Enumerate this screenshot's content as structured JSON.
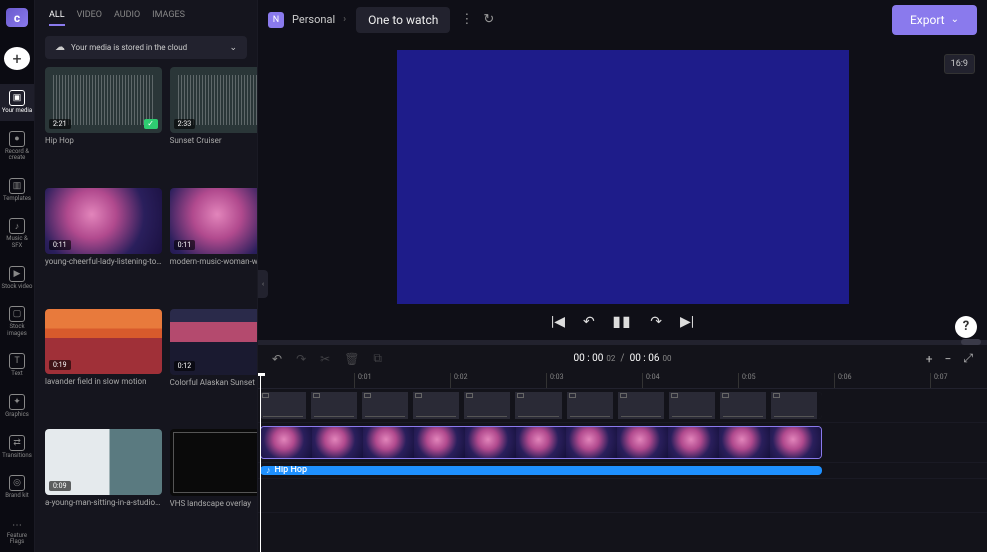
{
  "rail": {
    "items": [
      {
        "label": "Your media"
      },
      {
        "label": "Record & create"
      },
      {
        "label": "Templates"
      },
      {
        "label": "Music & SFX"
      },
      {
        "label": "Stock video"
      },
      {
        "label": "Stock images"
      },
      {
        "label": "Text"
      },
      {
        "label": "Graphics"
      },
      {
        "label": "Transitions"
      },
      {
        "label": "Brand kit"
      }
    ],
    "flags_label": "Feature Flags"
  },
  "tabs": {
    "all": "ALL",
    "video": "VIDEO",
    "audio": "AUDIO",
    "images": "IMAGES"
  },
  "cloud_bar": "Your media is stored in the cloud",
  "media": [
    {
      "dur": "2:21",
      "name": "Hip Hop",
      "check": true,
      "style": "audio"
    },
    {
      "dur": "2:33",
      "name": "Sunset Cruiser",
      "check": false,
      "style": "audio"
    },
    {
      "dur": "0:11",
      "name": "young-cheerful-lady-listening-to…",
      "check": false,
      "style": "woman"
    },
    {
      "dur": "0:11",
      "name": "modern-music-woman-wearing-…",
      "check": true,
      "style": "woman"
    },
    {
      "dur": "0:19",
      "name": "lavander field in slow motion",
      "check": false,
      "style": "lavender"
    },
    {
      "dur": "0:12",
      "name": "Colorful Alaskan Sunset",
      "check": false,
      "style": "alaska"
    },
    {
      "dur": "0:09",
      "name": "a-young-man-sitting-in-a-studio…",
      "check": false,
      "style": "man"
    },
    {
      "dur": "",
      "name": "VHS landscape overlay",
      "check": true,
      "style": "vhs"
    }
  ],
  "topbar": {
    "workspace_initial": "N",
    "workspace": "Personal",
    "project": "One to watch",
    "export": "Export"
  },
  "preview": {
    "aspect": "16:9"
  },
  "timeline": {
    "current": "00 : 00",
    "current_frames": "02",
    "total": "00 : 06",
    "total_frames": "00",
    "separator": "/",
    "ticks": [
      "0:01",
      "0:02",
      "0:03",
      "0:04",
      "0:05",
      "0:06",
      "0:07"
    ],
    "audio_clip_name": "Hip Hop"
  }
}
